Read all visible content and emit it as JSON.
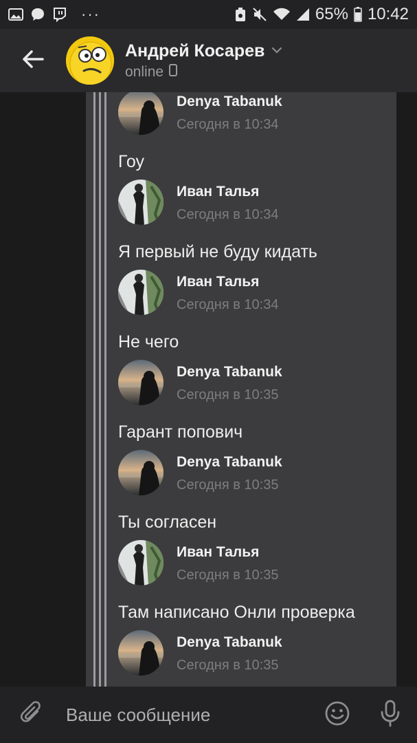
{
  "status_bar": {
    "battery": "65%",
    "time": "10:42",
    "more": "···",
    "left_icons": [
      "gallery-icon",
      "chat-bubble-icon",
      "twitch-icon"
    ],
    "right_icons": [
      "recycle-icon",
      "mute-icon",
      "wifi-icon",
      "signal-icon",
      "battery-icon"
    ]
  },
  "header": {
    "title": "Андрей Косарев",
    "status": "online",
    "back_icon": "arrow-left-icon",
    "dropdown_icon": "chevron-down-icon",
    "device_icon": "phone-icon"
  },
  "forwarded_messages": [
    {
      "author": "Denya Tabanuk",
      "time": "Сегодня в 10:34",
      "text": "Гоу",
      "avatar": "denya"
    },
    {
      "author": "Иван Талья",
      "time": "Сегодня в 10:34",
      "text": "Я первый не буду кидать",
      "avatar": "ivan"
    },
    {
      "author": "Иван Талья",
      "time": "Сегодня в 10:34",
      "text": "Не чего",
      "avatar": "ivan"
    },
    {
      "author": "Denya Tabanuk",
      "time": "Сегодня в 10:35",
      "text": "Гарант попович",
      "avatar": "denya"
    },
    {
      "author": "Denya Tabanuk",
      "time": "Сегодня в 10:35",
      "text": "Ты согласен",
      "avatar": "denya"
    },
    {
      "author": "Иван Талья",
      "time": "Сегодня в 10:35",
      "text": "Там написано Онли проверка",
      "avatar": "ivan"
    },
    {
      "author": "Denya Tabanuk",
      "time": "Сегодня в 10:35",
      "text": "",
      "avatar": "denya"
    }
  ],
  "input_bar": {
    "placeholder": "Ваше сообщение",
    "value": "",
    "icons": [
      "paperclip-icon",
      "smile-icon",
      "microphone-icon"
    ]
  },
  "scroll_button": {
    "icon": "chevron-down-icon"
  },
  "colors": {
    "background": "#1b1b1c",
    "header": "#2a2a2c",
    "card": "#3c3c3e",
    "timestamp": "#7d7d80",
    "avatar_yellow": "#f3c90f"
  }
}
